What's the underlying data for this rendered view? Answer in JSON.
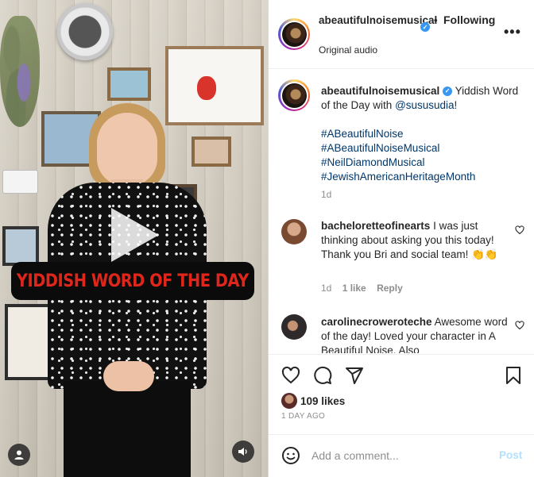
{
  "video": {
    "overlay_caption": "YIDDISH WORD OF THE DAY",
    "play_icon": "play-icon",
    "user_icon": "user-icon",
    "audio_icon": "speaker-icon",
    "caption_color": "#e0261b"
  },
  "header": {
    "username": "abeautifulnoisemusical",
    "separator": "•",
    "follow_label": "Following",
    "audio_label": "Original audio",
    "more_icon": "more-icon",
    "verified_icon": "verified-badge-icon"
  },
  "caption": {
    "username": "abeautifulnoisemusical",
    "text": "Yiddish Word of the Day with",
    "mention": "@sususudia!",
    "hashtags": [
      "#ABeautifulNoise",
      "#ABeautifulNoiseMusical",
      "#NeilDiamondMusical",
      "#JewishAmericanHeritageMonth"
    ],
    "time": "1d"
  },
  "comments": [
    {
      "username": "bacheloretteofinearts",
      "text": "I was just thinking about asking you this today! Thank you Bri and social team! 👏👏",
      "time": "1d",
      "likes": "1 like",
      "reply_label": "Reply"
    },
    {
      "username": "carolinecroweroteche",
      "text": "Awesome word of the day! Loved your character in A Beautiful Noise. Also"
    }
  ],
  "actions": {
    "like_icon": "heart-icon",
    "comment_icon": "comment-icon",
    "share_icon": "send-icon",
    "save_icon": "bookmark-icon",
    "likes": "109 likes",
    "time_ago": "1 DAY AGO"
  },
  "add_comment": {
    "placeholder": "Add a comment...",
    "post_label": "Post",
    "emoji_icon": "emoji-icon"
  },
  "colors": {
    "link": "#00376b",
    "verified": "#3897f0",
    "muted": "#8e8e8e",
    "post_disabled": "#b2dffc"
  }
}
